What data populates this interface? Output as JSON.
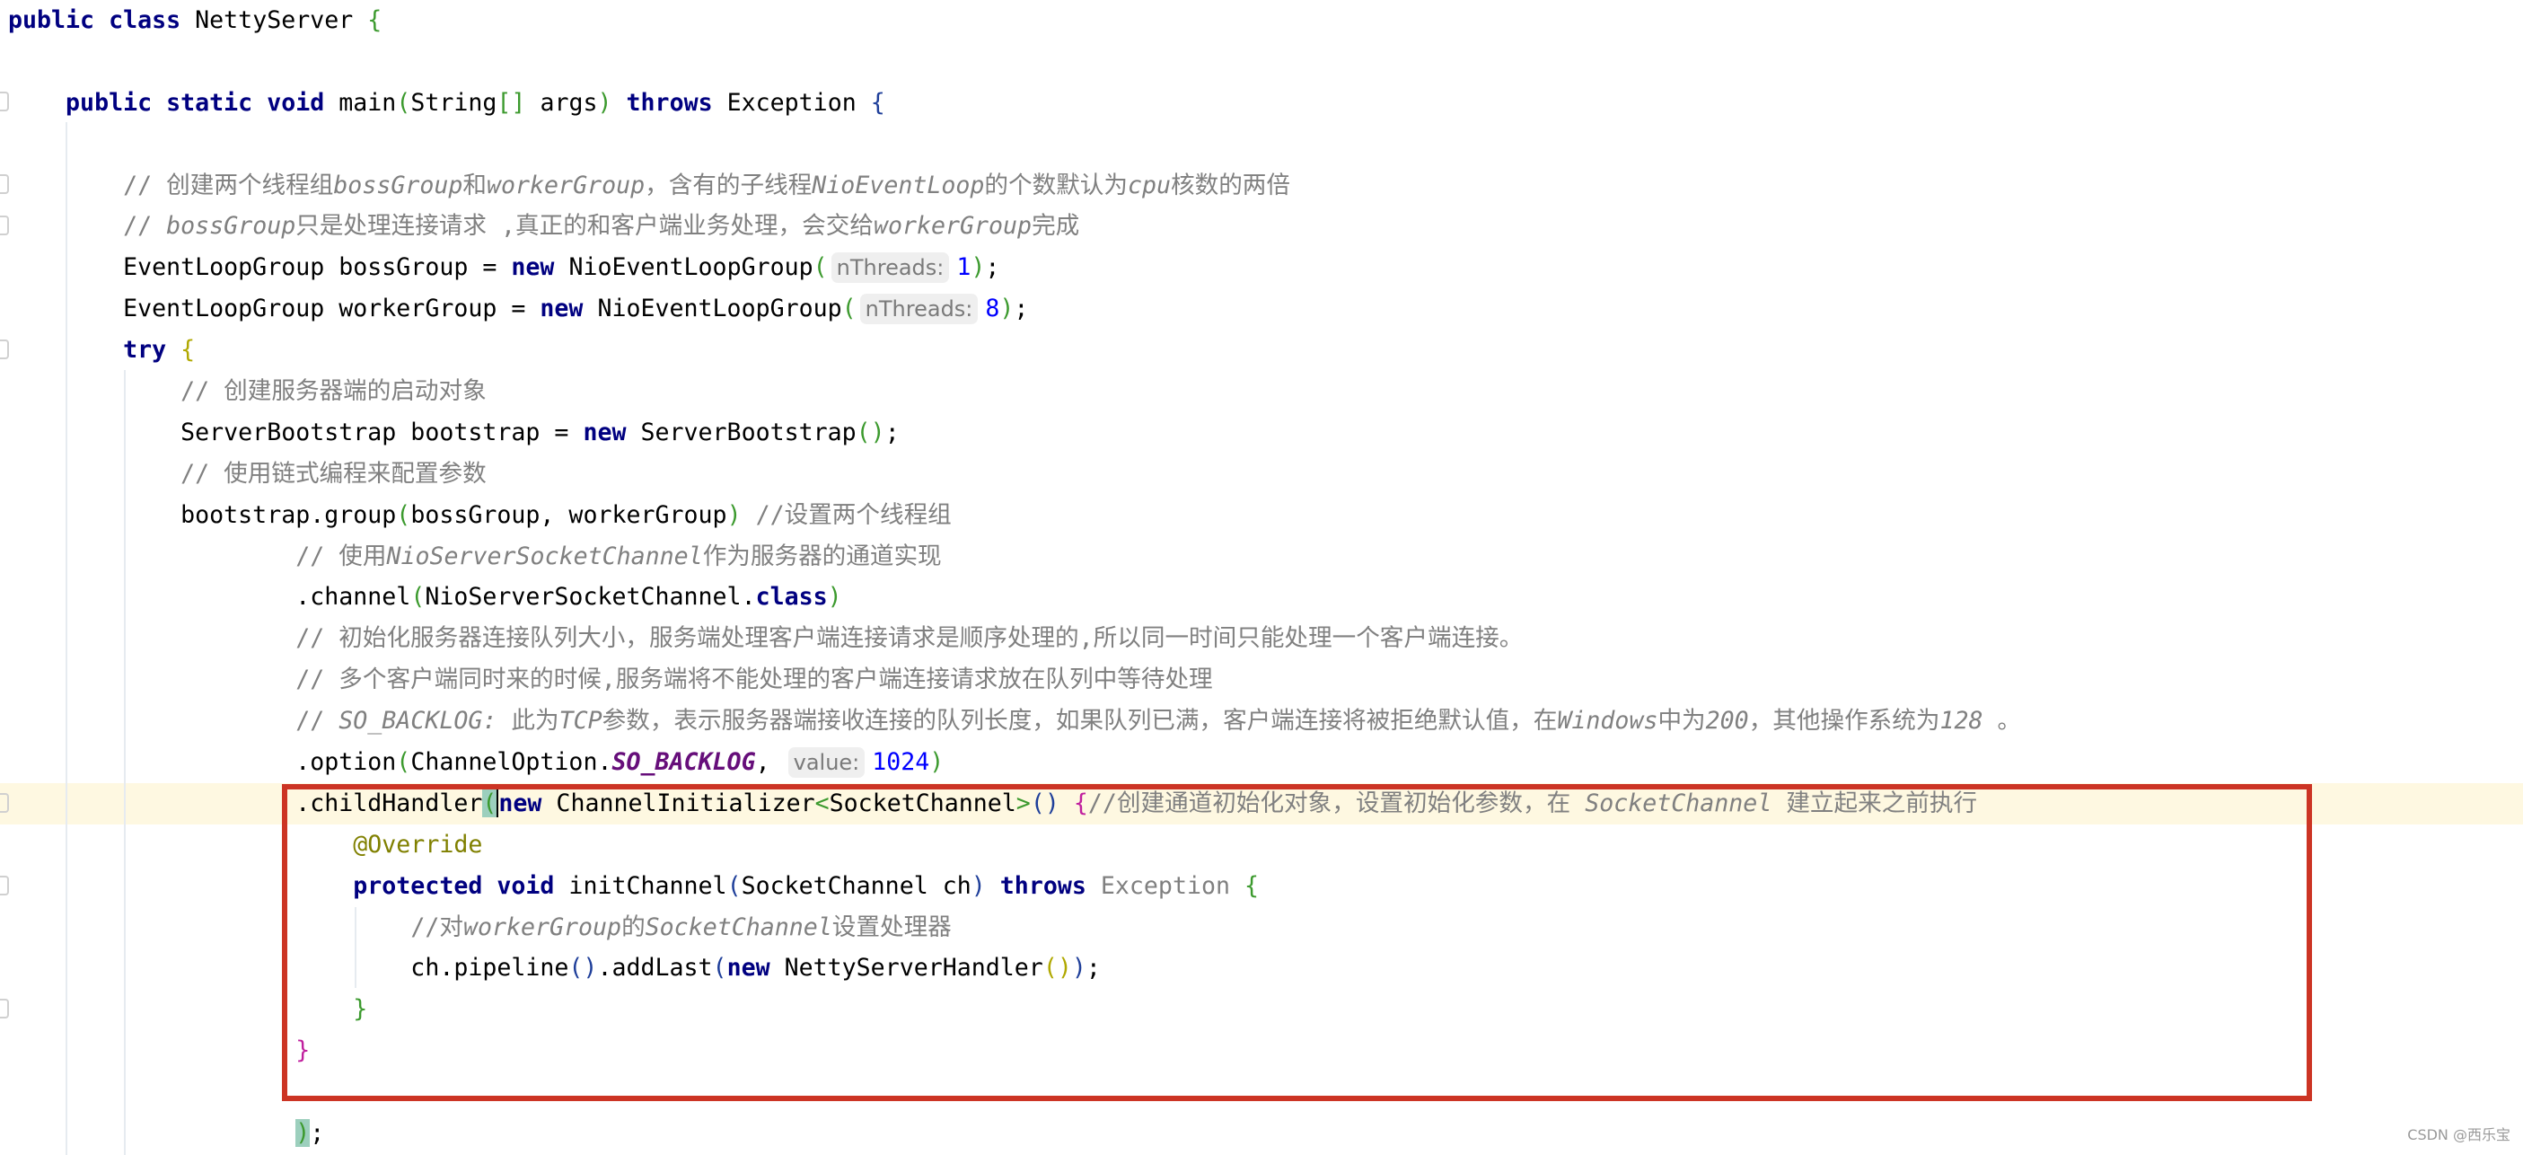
{
  "colors": {
    "keyword": "#000080",
    "comment": "#808080",
    "number": "#0000ff",
    "highlight_box": "#cc3424",
    "current_line": "#fef8e1"
  },
  "lines": [
    [
      [
        "public class",
        "k"
      ],
      [
        " NettyServer ",
        ""
      ],
      [
        "{",
        "bg"
      ]
    ],
    [],
    [
      [
        "    ",
        ""
      ],
      [
        "public static void",
        "k"
      ],
      [
        " main",
        ""
      ],
      [
        "(",
        "bg"
      ],
      [
        "String",
        ""
      ],
      [
        "[]",
        "bg"
      ],
      [
        " args",
        ""
      ],
      [
        ")",
        "bg"
      ],
      [
        " ",
        ""
      ],
      [
        "throws",
        "k"
      ],
      [
        " Exception ",
        ""
      ],
      [
        "{",
        "bb"
      ]
    ],
    [],
    [
      [
        "        ",
        ""
      ],
      [
        "// 创建两个线程组",
        "c"
      ],
      [
        "bossGroup",
        "ci"
      ],
      [
        "和",
        "c"
      ],
      [
        "workerGroup",
        "ci"
      ],
      [
        "，含有的子线程",
        "c"
      ],
      [
        "NioEventLoop",
        "ci"
      ],
      [
        "的个数默认为",
        "c"
      ],
      [
        "cpu",
        "ci"
      ],
      [
        "核数的两倍",
        "c"
      ]
    ],
    [
      [
        "        ",
        ""
      ],
      [
        "// ",
        "c"
      ],
      [
        "bossGroup",
        "ci"
      ],
      [
        "只是处理连接请求 ,真正的和客户端业务处理，会交给",
        "c"
      ],
      [
        "workerGroup",
        "ci"
      ],
      [
        "完成",
        "c"
      ]
    ],
    [
      [
        "        EventLoopGroup bossGroup = ",
        ""
      ],
      [
        "new",
        "k"
      ],
      [
        " NioEventLoopGroup",
        ""
      ],
      [
        "(",
        "bg"
      ],
      [
        "nThreads:",
        "h"
      ],
      [
        "1",
        "n"
      ],
      [
        ")",
        "bg"
      ],
      [
        ";",
        ""
      ]
    ],
    [
      [
        "        EventLoopGroup workerGroup = ",
        ""
      ],
      [
        "new",
        "k"
      ],
      [
        " NioEventLoopGroup",
        ""
      ],
      [
        "(",
        "bg"
      ],
      [
        "nThreads:",
        "h"
      ],
      [
        "8",
        "n"
      ],
      [
        ")",
        "bg"
      ],
      [
        ";",
        ""
      ]
    ],
    [
      [
        "        ",
        ""
      ],
      [
        "try",
        "k"
      ],
      [
        " ",
        ""
      ],
      [
        "{",
        "by"
      ]
    ],
    [
      [
        "            ",
        ""
      ],
      [
        "// 创建服务器端的启动对象",
        "c"
      ]
    ],
    [
      [
        "            ServerBootstrap bootstrap = ",
        ""
      ],
      [
        "new",
        "k"
      ],
      [
        " ServerBootstrap",
        ""
      ],
      [
        "()",
        "bg"
      ],
      [
        ";",
        ""
      ]
    ],
    [
      [
        "            ",
        ""
      ],
      [
        "// 使用链式编程来配置参数",
        "c"
      ]
    ],
    [
      [
        "            bootstrap.group",
        ""
      ],
      [
        "(",
        "bg"
      ],
      [
        "bossGroup, workerGroup",
        ""
      ],
      [
        ")",
        "bg"
      ],
      [
        " ",
        ""
      ],
      [
        "//设置两个线程组",
        "c"
      ]
    ],
    [
      [
        "                    ",
        ""
      ],
      [
        "// 使用",
        "c"
      ],
      [
        "NioServerSocketChannel",
        "ci"
      ],
      [
        "作为服务器的通道实现",
        "c"
      ]
    ],
    [
      [
        "                    .channel",
        ""
      ],
      [
        "(",
        "bg"
      ],
      [
        "NioServerSocketChannel.",
        ""
      ],
      [
        "class",
        "k"
      ],
      [
        ")",
        "bg"
      ]
    ],
    [
      [
        "                    ",
        ""
      ],
      [
        "// 初始化服务器连接队列大小，服务端处理客户端连接请求是顺序处理的,所以同一时间只能处理一个客户端连接。",
        "c"
      ]
    ],
    [
      [
        "                    ",
        ""
      ],
      [
        "// 多个客户端同时来的时候,服务端将不能处理的客户端连接请求放在队列中等待处理",
        "c"
      ]
    ],
    [
      [
        "                    ",
        ""
      ],
      [
        "// ",
        "c"
      ],
      [
        "SO_BACKLOG:",
        "ci"
      ],
      [
        " 此为",
        "c"
      ],
      [
        "TCP",
        "ci"
      ],
      [
        "参数，表示服务器端接收连接的队列长度，如果队列已满，客户端连接将被拒绝默认值，在",
        "c"
      ],
      [
        "Windows",
        "ci"
      ],
      [
        "中为",
        "c"
      ],
      [
        "200",
        "ci"
      ],
      [
        "，其他操作系统为",
        "c"
      ],
      [
        "128",
        "ci"
      ],
      [
        " 。",
        "c"
      ]
    ],
    [
      [
        "                    .option",
        ""
      ],
      [
        "(",
        "bg"
      ],
      [
        "ChannelOption.",
        ""
      ],
      [
        "SO_BACKLOG",
        "p"
      ],
      [
        ", ",
        ""
      ],
      [
        "value:",
        "h"
      ],
      [
        "1024",
        "n"
      ],
      [
        ")",
        "bg"
      ]
    ],
    [
      [
        "                    .childHandler",
        ""
      ],
      [
        "(",
        "bg hl"
      ],
      [
        "new",
        "k caret"
      ],
      [
        " ChannelInitializer",
        ""
      ],
      [
        "<",
        "bg"
      ],
      [
        "SocketChannel",
        ""
      ],
      [
        ">",
        "bg"
      ],
      [
        "()",
        "bb"
      ],
      [
        " ",
        ""
      ],
      [
        "{",
        "bm"
      ],
      [
        "//创建通道初始化对象，设置初始化参数，在 ",
        "c"
      ],
      [
        "SocketChannel",
        "ci"
      ],
      [
        " 建立起来之前执行",
        "c"
      ]
    ],
    [
      [
        "                        ",
        ""
      ],
      [
        "@Override",
        "a"
      ]
    ],
    [
      [
        "                        ",
        ""
      ],
      [
        "protected void",
        "k"
      ],
      [
        " initChannel",
        ""
      ],
      [
        "(",
        "bb"
      ],
      [
        "SocketChannel ch",
        ""
      ],
      [
        ")",
        "bb"
      ],
      [
        " ",
        ""
      ],
      [
        "throws",
        "k"
      ],
      [
        " ",
        ""
      ],
      [
        "Exception",
        "g"
      ],
      [
        " ",
        ""
      ],
      [
        "{",
        "bg"
      ]
    ],
    [
      [
        "                            ",
        ""
      ],
      [
        "//对",
        "c"
      ],
      [
        "workerGroup",
        "ci"
      ],
      [
        "的",
        "c"
      ],
      [
        "SocketChannel",
        "ci"
      ],
      [
        "设置处理器",
        "c"
      ]
    ],
    [
      [
        "                            ch.pipeline",
        ""
      ],
      [
        "()",
        "bb"
      ],
      [
        ".addLast",
        ""
      ],
      [
        "(",
        "bb"
      ],
      [
        "new",
        "k"
      ],
      [
        " NettyServerHandler",
        ""
      ],
      [
        "()",
        "by"
      ],
      [
        ")",
        "bb"
      ],
      [
        ";",
        ""
      ]
    ],
    [
      [
        "                        ",
        ""
      ],
      [
        "}",
        "bg"
      ]
    ],
    [
      [
        "                    ",
        ""
      ],
      [
        "}",
        "bm"
      ]
    ],
    [],
    [
      [
        "                    ",
        ""
      ],
      [
        ")",
        "bg hl"
      ],
      [
        ";",
        ""
      ]
    ]
  ],
  "current_line_index": 19,
  "watermark": "CSDN @西乐宝"
}
